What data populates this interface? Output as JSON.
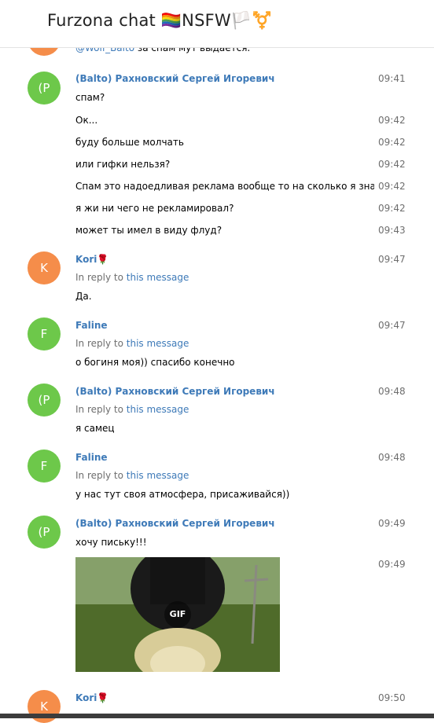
{
  "header": {
    "title": "Furzona chat 🏳️‍🌈NSFW🏳️⚧️"
  },
  "partial_message": {
    "mention": "@Wolf_Balto",
    "text": "за спам мут выдается."
  },
  "groups": [
    {
      "avatar": "(P",
      "avatar_color": "#6dc84a",
      "name": "(Balto) Рахновский Сергей Игоревич",
      "messages": [
        {
          "text": "спам?",
          "time": "09:41"
        },
        {
          "text": "Ок...",
          "time": "09:42"
        },
        {
          "text": "буду больше молчать",
          "time": "09:42"
        },
        {
          "text": "или гифки нельзя?",
          "time": "09:42"
        },
        {
          "text": "Спам это надоедливая реклама вообще то на сколько я знаю...\\",
          "time": "09:42"
        },
        {
          "text": "я жи ни чего не рекламировал?",
          "time": "09:42"
        },
        {
          "text": "может ты имел в виду флуд?",
          "time": "09:43"
        }
      ]
    },
    {
      "avatar": "K",
      "avatar_color": "#f58d4a",
      "name": "Kori🌹",
      "time": "09:47",
      "reply_prefix": "In reply to",
      "reply_link": "this message",
      "text": "Да."
    },
    {
      "avatar": "F",
      "avatar_color": "#6dc84a",
      "name": "Faline",
      "time": "09:47",
      "reply_prefix": "In reply to",
      "reply_link": "this message",
      "text": "о богиня моя)) спасибо конечно"
    },
    {
      "avatar": "(P",
      "avatar_color": "#6dc84a",
      "name": "(Balto) Рахновский Сергей Игоревич",
      "time": "09:48",
      "reply_prefix": "In reply to",
      "reply_link": "this message",
      "text": "я самец"
    },
    {
      "avatar": "F",
      "avatar_color": "#6dc84a",
      "name": "Faline",
      "time": "09:48",
      "reply_prefix": "In reply to",
      "reply_link": "this message",
      "text": "у нас тут своя атмосфера, присаживайся))"
    },
    {
      "avatar": "(P",
      "avatar_color": "#6dc84a",
      "name": "(Balto) Рахновский Сергей Игоревич",
      "time": "09:49",
      "text": "хочу письку!!!",
      "media": {
        "badge": "GIF",
        "time": "09:49"
      }
    },
    {
      "avatar": "K",
      "avatar_color": "#f58d4a",
      "name": "Kori🌹",
      "time": "09:50"
    }
  ]
}
